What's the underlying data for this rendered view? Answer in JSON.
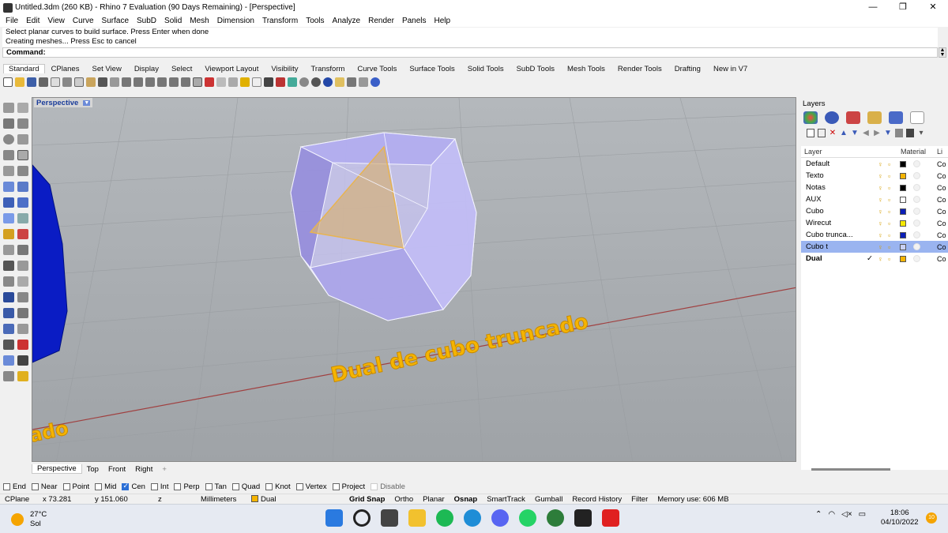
{
  "window": {
    "title": "Untitled.3dm (260 KB) - Rhino 7 Evaluation (90 Days Remaining) - [Perspective]",
    "minimize": "—",
    "maximize": "❐",
    "close": "✕"
  },
  "menu": [
    "File",
    "Edit",
    "View",
    "Curve",
    "Surface",
    "SubD",
    "Solid",
    "Mesh",
    "Dimension",
    "Transform",
    "Tools",
    "Analyze",
    "Render",
    "Panels",
    "Help"
  ],
  "command": {
    "history": [
      "Select planar curves to build surface. Press Enter when done",
      "Creating meshes... Press Esc to cancel"
    ],
    "prompt": "Command:",
    "value": ""
  },
  "toolbar_tabs": [
    "Standard",
    "CPlanes",
    "Set View",
    "Display",
    "Select",
    "Viewport Layout",
    "Visibility",
    "Transform",
    "Curve Tools",
    "Surface Tools",
    "Solid Tools",
    "SubD Tools",
    "Mesh Tools",
    "Render Tools",
    "Drafting",
    "New in V7"
  ],
  "viewport": {
    "label": "Perspective",
    "text3d": "Dual de cubo truncado",
    "text3d_partial": "ado",
    "tabs": [
      "Perspective",
      "Top",
      "Front",
      "Right"
    ],
    "add_tab": "+"
  },
  "layers": {
    "title": "Layers",
    "columns": [
      "Layer",
      "Material",
      "Li"
    ],
    "rows": [
      {
        "name": "Default",
        "color": "#000000",
        "current": "",
        "linetype": "Co"
      },
      {
        "name": "Texto",
        "color": "#f5b400",
        "current": "",
        "linetype": "Co"
      },
      {
        "name": "Notas",
        "color": "#000000",
        "current": "",
        "linetype": "Co"
      },
      {
        "name": "AUX",
        "color": "#ffffff",
        "current": "",
        "linetype": "Co"
      },
      {
        "name": "Cubo",
        "color": "#0b1fb8",
        "current": "",
        "linetype": "Co"
      },
      {
        "name": "Wirecut",
        "color": "#f5e800",
        "current": "",
        "linetype": "Co"
      },
      {
        "name": "Cubo trunca...",
        "color": "#0b1fb8",
        "current": "",
        "linetype": "Co"
      },
      {
        "name": "Cubo t",
        "color": "#c8d0f4",
        "current": "",
        "linetype": "Co"
      },
      {
        "name": "Dual",
        "color": "#f5b400",
        "current": "✓",
        "linetype": "Co"
      }
    ]
  },
  "osnap": [
    {
      "label": "End",
      "checked": false
    },
    {
      "label": "Near",
      "checked": false
    },
    {
      "label": "Point",
      "checked": false
    },
    {
      "label": "Mid",
      "checked": false
    },
    {
      "label": "Cen",
      "checked": true
    },
    {
      "label": "Int",
      "checked": false
    },
    {
      "label": "Perp",
      "checked": false
    },
    {
      "label": "Tan",
      "checked": false
    },
    {
      "label": "Quad",
      "checked": false
    },
    {
      "label": "Knot",
      "checked": false
    },
    {
      "label": "Vertex",
      "checked": false
    },
    {
      "label": "Project",
      "checked": false
    },
    {
      "label": "Disable",
      "checked": false
    }
  ],
  "status": {
    "cplane": "CPlane",
    "x": "x 73.281",
    "y": "y 151.060",
    "z": "z",
    "units": "Millimeters",
    "layer": "Dual",
    "toggles": [
      "Grid Snap",
      "Ortho",
      "Planar",
      "Osnap",
      "SmartTrack",
      "Gumball",
      "Record History",
      "Filter"
    ],
    "memory": "Memory use: 606 MB"
  },
  "taskbar": {
    "temp": "27°C",
    "weather": "Sol",
    "time": "18:06",
    "date": "04/10/2022",
    "notifications": "10"
  },
  "colors": {
    "viewport_bg": "#a8acb0",
    "accent": "#2b6fd6",
    "text3d": "#f5b400",
    "selection": "#9ab4f0"
  }
}
